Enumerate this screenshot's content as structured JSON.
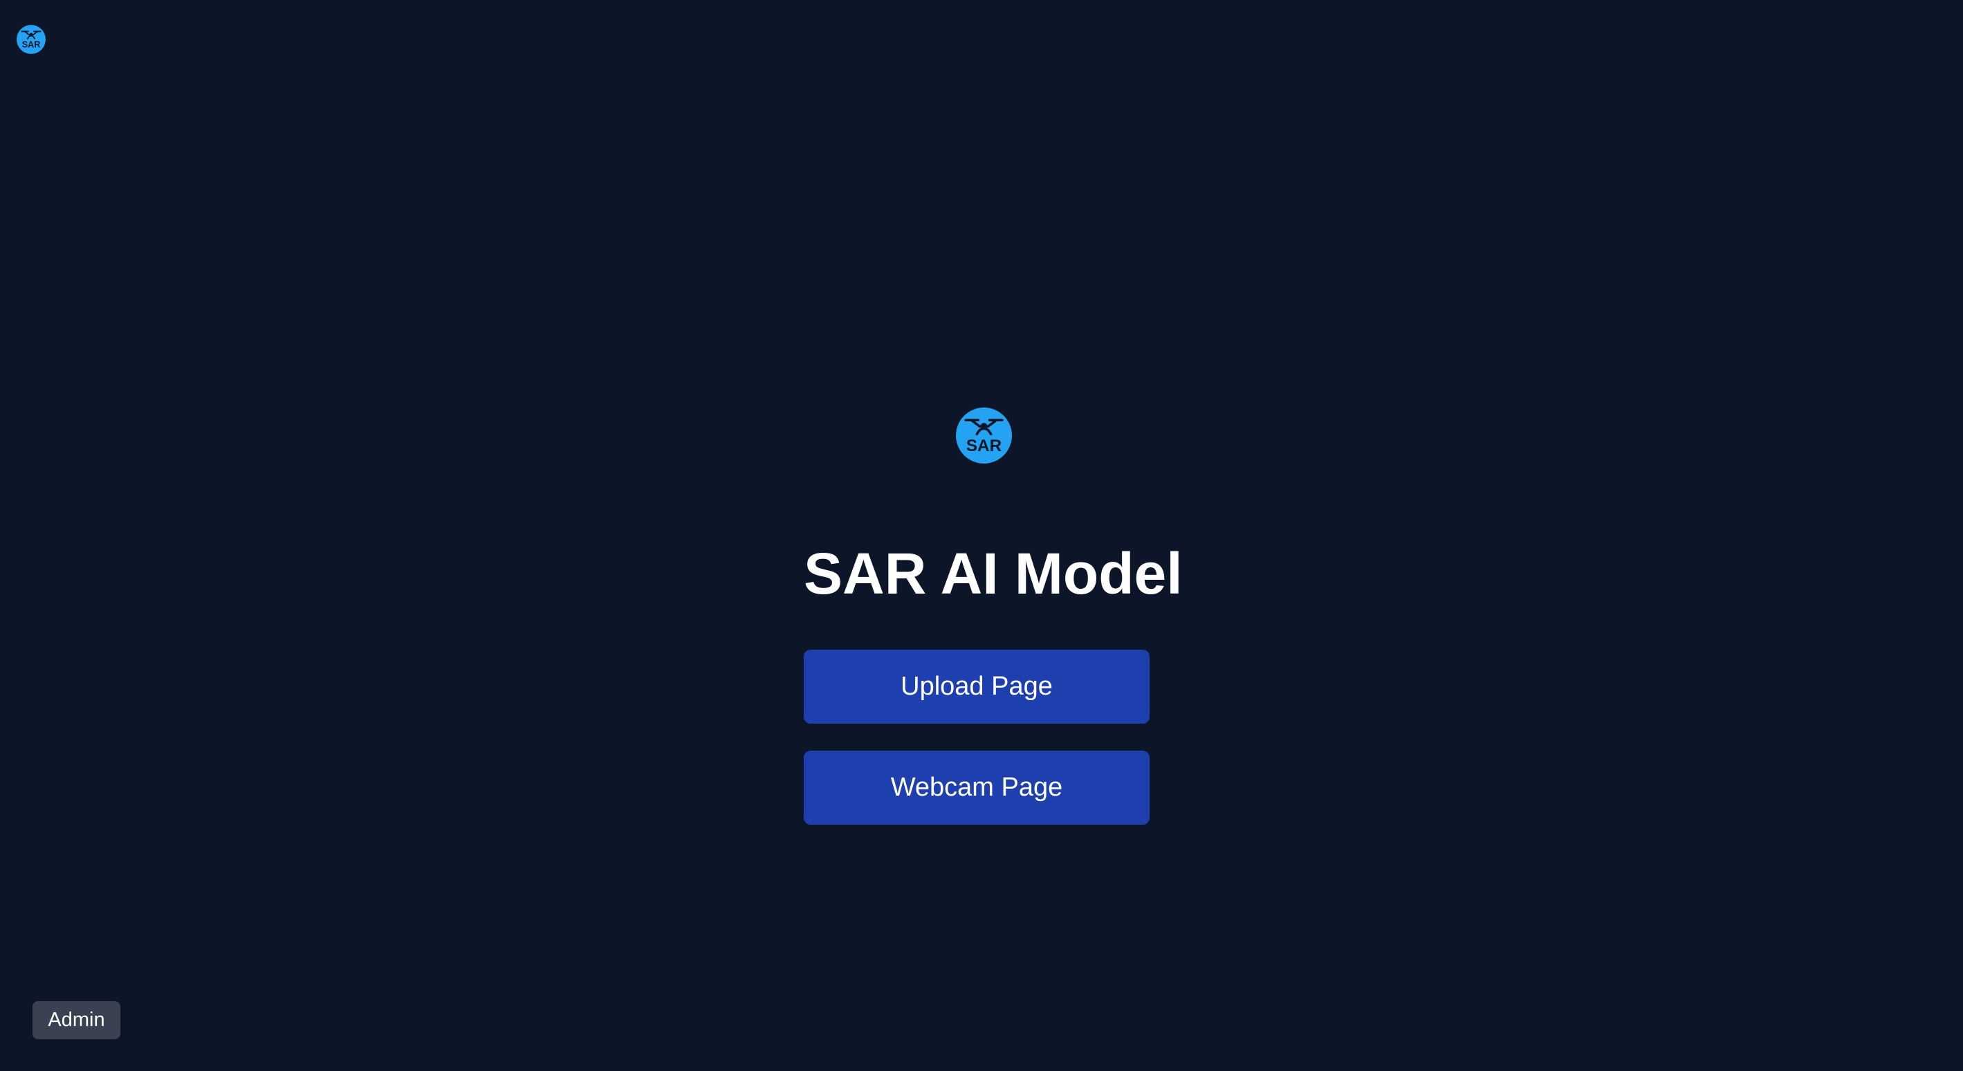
{
  "logo": {
    "icon": "drone-icon",
    "text": "SAR",
    "color": "#24a3f2"
  },
  "page": {
    "title": "SAR AI Model",
    "background": "#0d1628"
  },
  "nav": {
    "upload_label": "Upload Page",
    "webcam_label": "Webcam Page",
    "button_color": "#1e40af"
  },
  "admin": {
    "label": "Admin",
    "color": "#3a4252"
  }
}
